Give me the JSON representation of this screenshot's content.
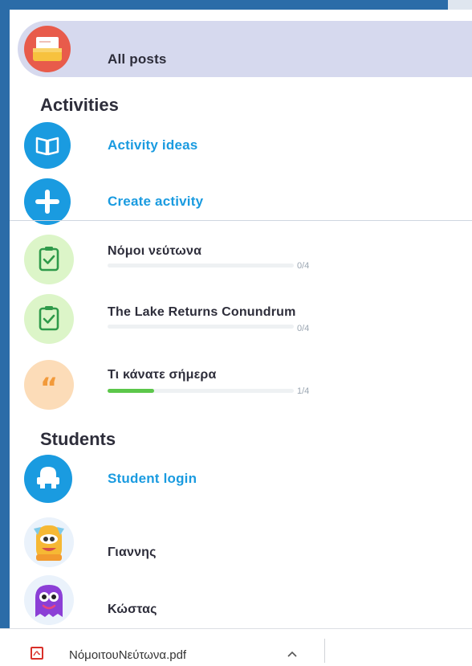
{
  "all_posts": {
    "label": "All posts"
  },
  "activities": {
    "title": "Activities",
    "idea_label": "Activity ideas",
    "create_label": "Create activity",
    "items": [
      {
        "title": "Νόμοι νεύτωνα",
        "progress_text": "0/4",
        "progress": 0.0
      },
      {
        "title": "The Lake Returns Conundrum",
        "progress_text": "0/4",
        "progress": 0.0
      },
      {
        "title": "Τι κάνατε σήμερα",
        "progress_text": "1/4",
        "progress": 0.25
      }
    ]
  },
  "students": {
    "title": "Students",
    "login_label": "Student login",
    "list": [
      {
        "name": "Γιαννης"
      },
      {
        "name": "Κώστας"
      }
    ]
  },
  "download": {
    "filename": "ΝόμοιτουΝεύτωνα.pdf"
  },
  "colors": {
    "accent_blue": "#1a9be0",
    "progress_green": "#5cc74a",
    "frame_blue": "#2b6ca8"
  }
}
